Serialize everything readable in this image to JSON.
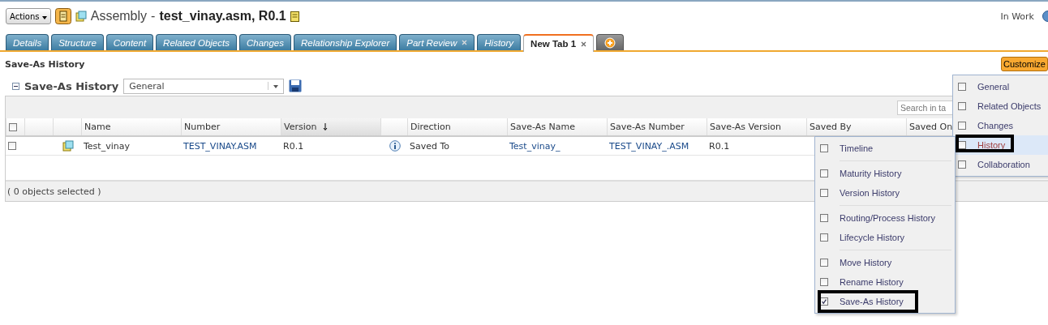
{
  "header": {
    "actions_button": "Actions",
    "object_type": "Assembly",
    "separator": "-",
    "object_name": "test_vinay.asm, R0.1",
    "state": "In Work"
  },
  "tabs": [
    {
      "label": "Details",
      "selected": false,
      "closable": false
    },
    {
      "label": "Structure",
      "selected": false,
      "closable": false
    },
    {
      "label": "Content",
      "selected": false,
      "closable": false
    },
    {
      "label": "Related Objects",
      "selected": false,
      "closable": false
    },
    {
      "label": "Changes",
      "selected": false,
      "closable": false
    },
    {
      "label": "Relationship Explorer",
      "selected": false,
      "closable": false
    },
    {
      "label": "Part Review",
      "selected": false,
      "closable": true
    },
    {
      "label": "History",
      "selected": false,
      "closable": false
    },
    {
      "label": "New Tab 1",
      "selected": true,
      "closable": true
    }
  ],
  "page_title": "Save-As History",
  "customize_button": "Customize",
  "table": {
    "title": "Save-As History",
    "view": "General",
    "search": {
      "placeholder": "Search in ta"
    },
    "all_checked": false,
    "columns": [
      {
        "label": "Name",
        "sorted": false
      },
      {
        "label": "Number",
        "sorted": false
      },
      {
        "label": "Version",
        "sorted": true
      },
      {
        "kind": "icon"
      },
      {
        "label": "Direction",
        "sorted": false
      },
      {
        "label": "Save-As Name",
        "sorted": false
      },
      {
        "label": "Save-As Number",
        "sorted": false
      },
      {
        "label": "Save-As Version",
        "sorted": false
      },
      {
        "label": "Saved By",
        "sorted": false
      },
      {
        "label": "Saved On",
        "sorted": false
      }
    ],
    "rows": [
      {
        "checked": false,
        "cells": [
          {
            "text": "Test_vinay",
            "link": false
          },
          {
            "text": "TEST_VINAY.ASM",
            "link": true
          },
          {
            "text": "R0.1",
            "link": false
          },
          {
            "kind": "info"
          },
          {
            "text": "Saved To",
            "link": false
          },
          {
            "text": "Test_vinay_",
            "link": true
          },
          {
            "text": "TEST_VINAY_.ASM",
            "link": true
          },
          {
            "text": "R0.1",
            "link": false
          }
        ]
      }
    ],
    "status": "( 0 objects selected )"
  },
  "customize_menu": {
    "items": [
      {
        "label": "General",
        "selected": false,
        "checked": false
      },
      {
        "label": "Related Objects",
        "selected": false,
        "checked": false
      },
      {
        "label": "Changes",
        "selected": false,
        "checked": false
      },
      {
        "label": "History",
        "selected": true,
        "checked": false
      },
      {
        "label": "Collaboration",
        "selected": false,
        "checked": false
      }
    ]
  },
  "history_submenu": {
    "groups": [
      {
        "items": [
          {
            "label": "Timeline",
            "checked": false
          }
        ]
      },
      {
        "items": [
          {
            "label": "Maturity History",
            "checked": false
          },
          {
            "label": "Version History",
            "checked": false
          }
        ]
      },
      {
        "items": [
          {
            "label": "Routing/Process History",
            "checked": false
          },
          {
            "label": "Lifecycle History",
            "checked": false
          }
        ]
      },
      {
        "items": [
          {
            "label": "Move History",
            "checked": false
          },
          {
            "label": "Rename History",
            "checked": false
          },
          {
            "label": "Save-As History",
            "checked": true
          }
        ]
      }
    ]
  }
}
